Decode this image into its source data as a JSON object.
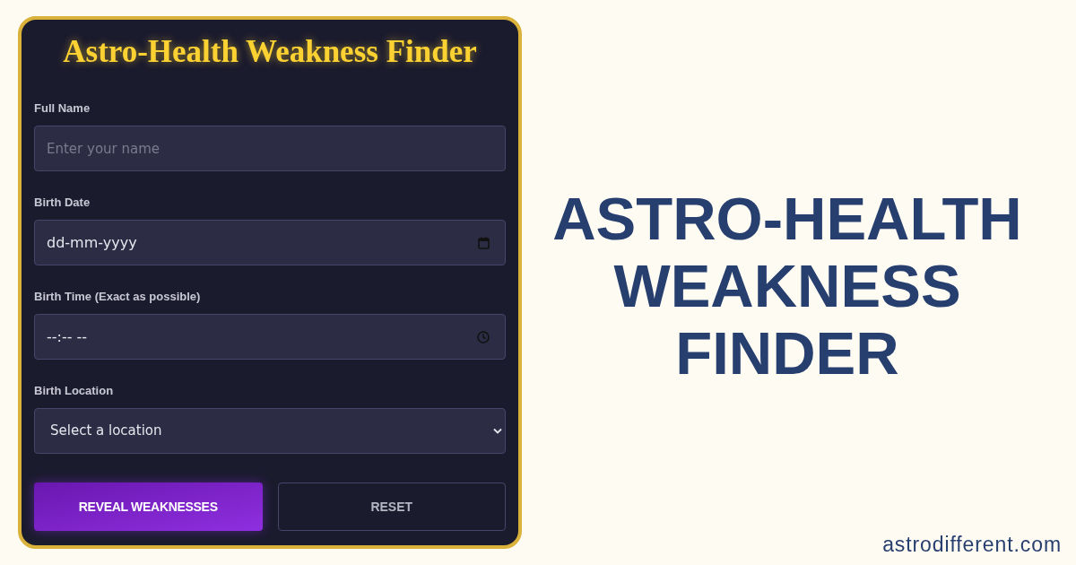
{
  "form": {
    "title": "Astro-Health Weakness Finder",
    "fields": [
      {
        "kind": "text",
        "label": "Full Name",
        "placeholder": "Enter your name"
      },
      {
        "kind": "date",
        "label": "Birth Date",
        "value": "dd-mm-yyyy"
      },
      {
        "kind": "time",
        "label": "Birth Time (Exact as possible)",
        "value": "--:-- --"
      },
      {
        "kind": "select",
        "label": "Birth Location",
        "value": "Select a location"
      }
    ],
    "buttons": [
      {
        "kind": "primary",
        "label": "REVEAL WEAKNESSES"
      },
      {
        "kind": "secondary",
        "label": "RESET"
      }
    ]
  },
  "banner": {
    "heading_lines": [
      "ASTRO-HEALTH",
      "WEAKNESS",
      "FINDER"
    ]
  },
  "footer": {
    "site": "astrodifferent.com"
  }
}
